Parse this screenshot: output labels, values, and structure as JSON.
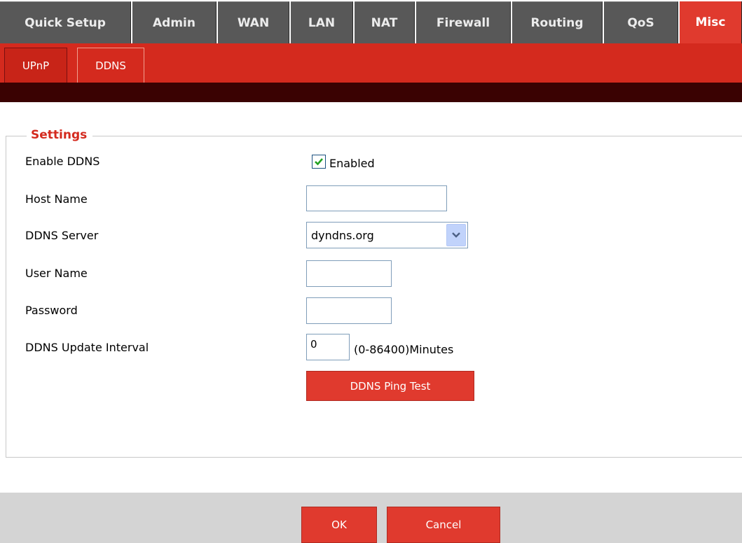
{
  "top_tabs": [
    {
      "label": "Quick Setup"
    },
    {
      "label": "Admin"
    },
    {
      "label": "WAN"
    },
    {
      "label": "LAN"
    },
    {
      "label": "NAT"
    },
    {
      "label": "Firewall"
    },
    {
      "label": "Routing"
    },
    {
      "label": "QoS"
    },
    {
      "label": "Misc"
    }
  ],
  "active_top_tab": "Misc",
  "sub_tabs": [
    {
      "label": "UPnP"
    },
    {
      "label": "DDNS"
    }
  ],
  "active_sub_tab": "DDNS",
  "settings": {
    "legend": "Settings",
    "enable_ddns": {
      "label": "Enable DDNS",
      "checked": true,
      "checkbox_label": "Enabled"
    },
    "host_name": {
      "label": "Host Name",
      "value": ""
    },
    "ddns_server": {
      "label": "DDNS Server",
      "value": "dyndns.org"
    },
    "user_name": {
      "label": "User Name",
      "value": ""
    },
    "password": {
      "label": "Password",
      "value": ""
    },
    "update_interval": {
      "label": "DDNS Update Interval",
      "value": "0",
      "hint": "(0-86400)Minutes"
    },
    "ping_test_label": "DDNS Ping Test"
  },
  "footer": {
    "ok_label": "OK",
    "cancel_label": "Cancel"
  },
  "colors": {
    "accent_red": "#e03a2e",
    "nav_gray": "#585858",
    "dark_bar": "#3a0202",
    "legend_red": "#d42a1e"
  }
}
